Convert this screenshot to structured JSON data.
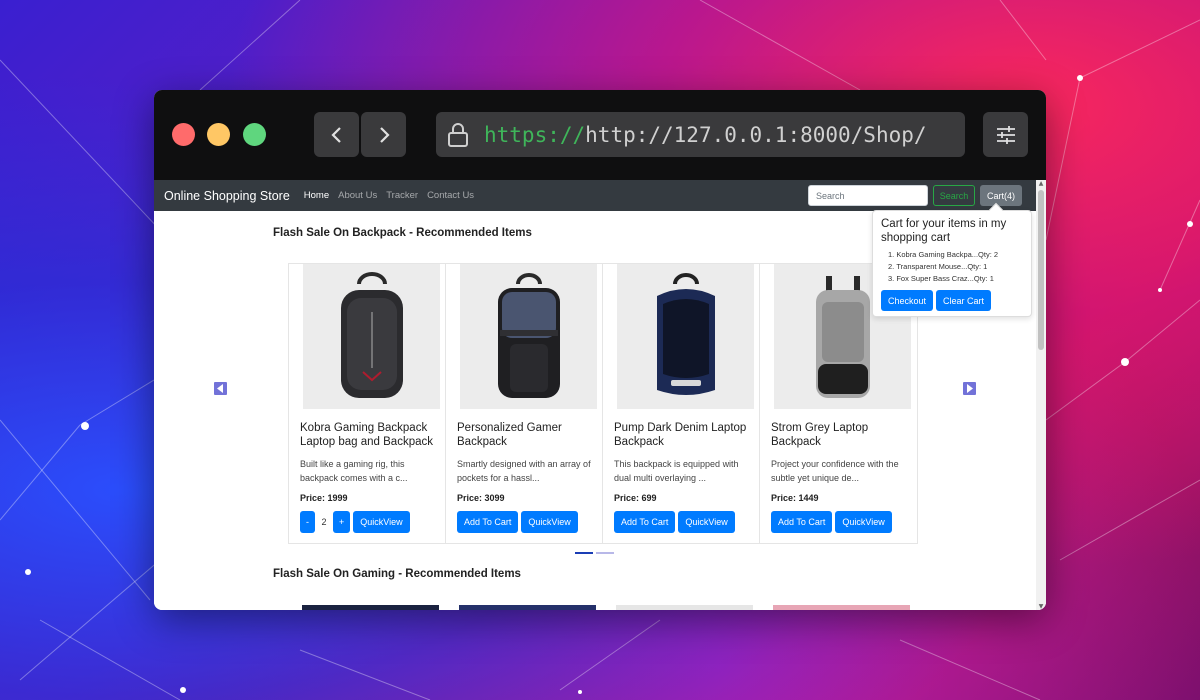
{
  "browser": {
    "url_scheme": "https://",
    "url_path": "http://127.0.0.1:8000/Shop/"
  },
  "navbar": {
    "brand": "Online Shopping Store",
    "links": [
      "Home",
      "About Us",
      "Tracker",
      "Contact Us"
    ],
    "search_placeholder": "Search",
    "search_button": "Search",
    "cart_button": "Cart(4)"
  },
  "cart_popover": {
    "title": "Cart for your items in my shopping cart",
    "items": [
      "Kobra Gaming Backpa...Qty: 2",
      "Transparent Mouse...Qty: 1",
      "Fox Super Bass Craz...Qty: 1"
    ],
    "checkout_label": "Checkout",
    "clear_label": "Clear Cart"
  },
  "sections": [
    {
      "title": "Flash Sale On Backpack - Recommended Items",
      "products": [
        {
          "title": "Kobra Gaming Backpack Laptop bag and Backpack",
          "desc": "Built like a gaming rig, this backpack comes with a c...",
          "price": "Price: 1999",
          "in_cart": true,
          "qty": "2",
          "minus": "-",
          "plus": "+",
          "quickview": "QuickView"
        },
        {
          "title": "Personalized Gamer Backpack",
          "desc": "Smartly designed with an array of pockets for a hassl...",
          "price": "Price: 3099",
          "add": "Add To Cart",
          "quickview": "QuickView"
        },
        {
          "title": "Pump Dark Denim Laptop Backpack",
          "desc": "This backpack is equipped with dual multi overlaying ...",
          "price": "Price: 699",
          "add": "Add To Cart",
          "quickview": "QuickView"
        },
        {
          "title": "Strom Grey Laptop Backpack",
          "desc": "Project your confidence with the subtle yet unique de...",
          "price": "Price: 1449",
          "add": "Add To Cart",
          "quickview": "QuickView"
        }
      ]
    },
    {
      "title": "Flash Sale On Gaming - Recommended Items"
    }
  ],
  "colors": {
    "primary": "#007bff",
    "navbar": "#343a40",
    "success": "#28a745",
    "secondary": "#6c757d"
  },
  "icons": [
    "lock-icon",
    "chevron-left-icon",
    "chevron-right-icon",
    "sliders-icon",
    "carousel-prev-icon",
    "carousel-next-icon"
  ]
}
